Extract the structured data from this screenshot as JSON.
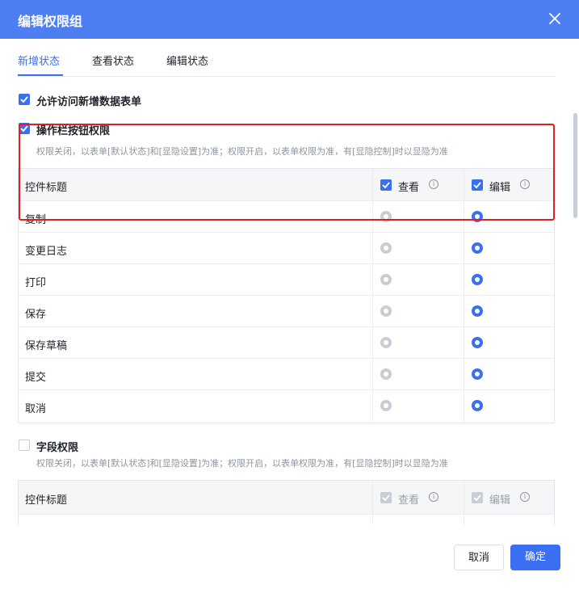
{
  "dialog": {
    "title": "编辑权限组"
  },
  "tabs": [
    {
      "label": "新增状态",
      "active": true
    },
    {
      "label": "查看状态",
      "active": false
    },
    {
      "label": "编辑状态",
      "active": false
    }
  ],
  "options": {
    "allow_access": {
      "label": "允许访问新增数据表单",
      "checked": true
    },
    "action_bar": {
      "label": "操作栏按钮权限",
      "checked": true,
      "hint": "权限关闭，以表单[默认状态]和[显隐设置]为准；权限开启，以表单权限为准，有[显隐控制]时以显隐为准"
    },
    "field_perm": {
      "label": "字段权限",
      "checked": false,
      "hint": "权限关闭，以表单[默认状态]和[显隐设置]为准；权限开启，以表单权限为准，有[显隐控制]时以显隐为准"
    }
  },
  "action_table": {
    "header": {
      "title": "控件标题",
      "view": "查看",
      "edit": "编辑"
    },
    "rows": [
      {
        "label": "复制",
        "selected": "edit"
      },
      {
        "label": "变更日志",
        "selected": "edit"
      },
      {
        "label": "打印",
        "selected": "edit"
      },
      {
        "label": "保存",
        "selected": "edit"
      },
      {
        "label": "保存草稿",
        "selected": "edit"
      },
      {
        "label": "提交",
        "selected": "edit"
      },
      {
        "label": "取消",
        "selected": "edit"
      }
    ]
  },
  "field_table": {
    "header": {
      "title": "控件标题",
      "view": "查看",
      "edit": "编辑"
    }
  },
  "footer": {
    "cancel": "取消",
    "ok": "确定"
  },
  "colors": {
    "primary": "#3a6ff2",
    "header": "#4e7ff2",
    "highlight": "#e02020"
  }
}
